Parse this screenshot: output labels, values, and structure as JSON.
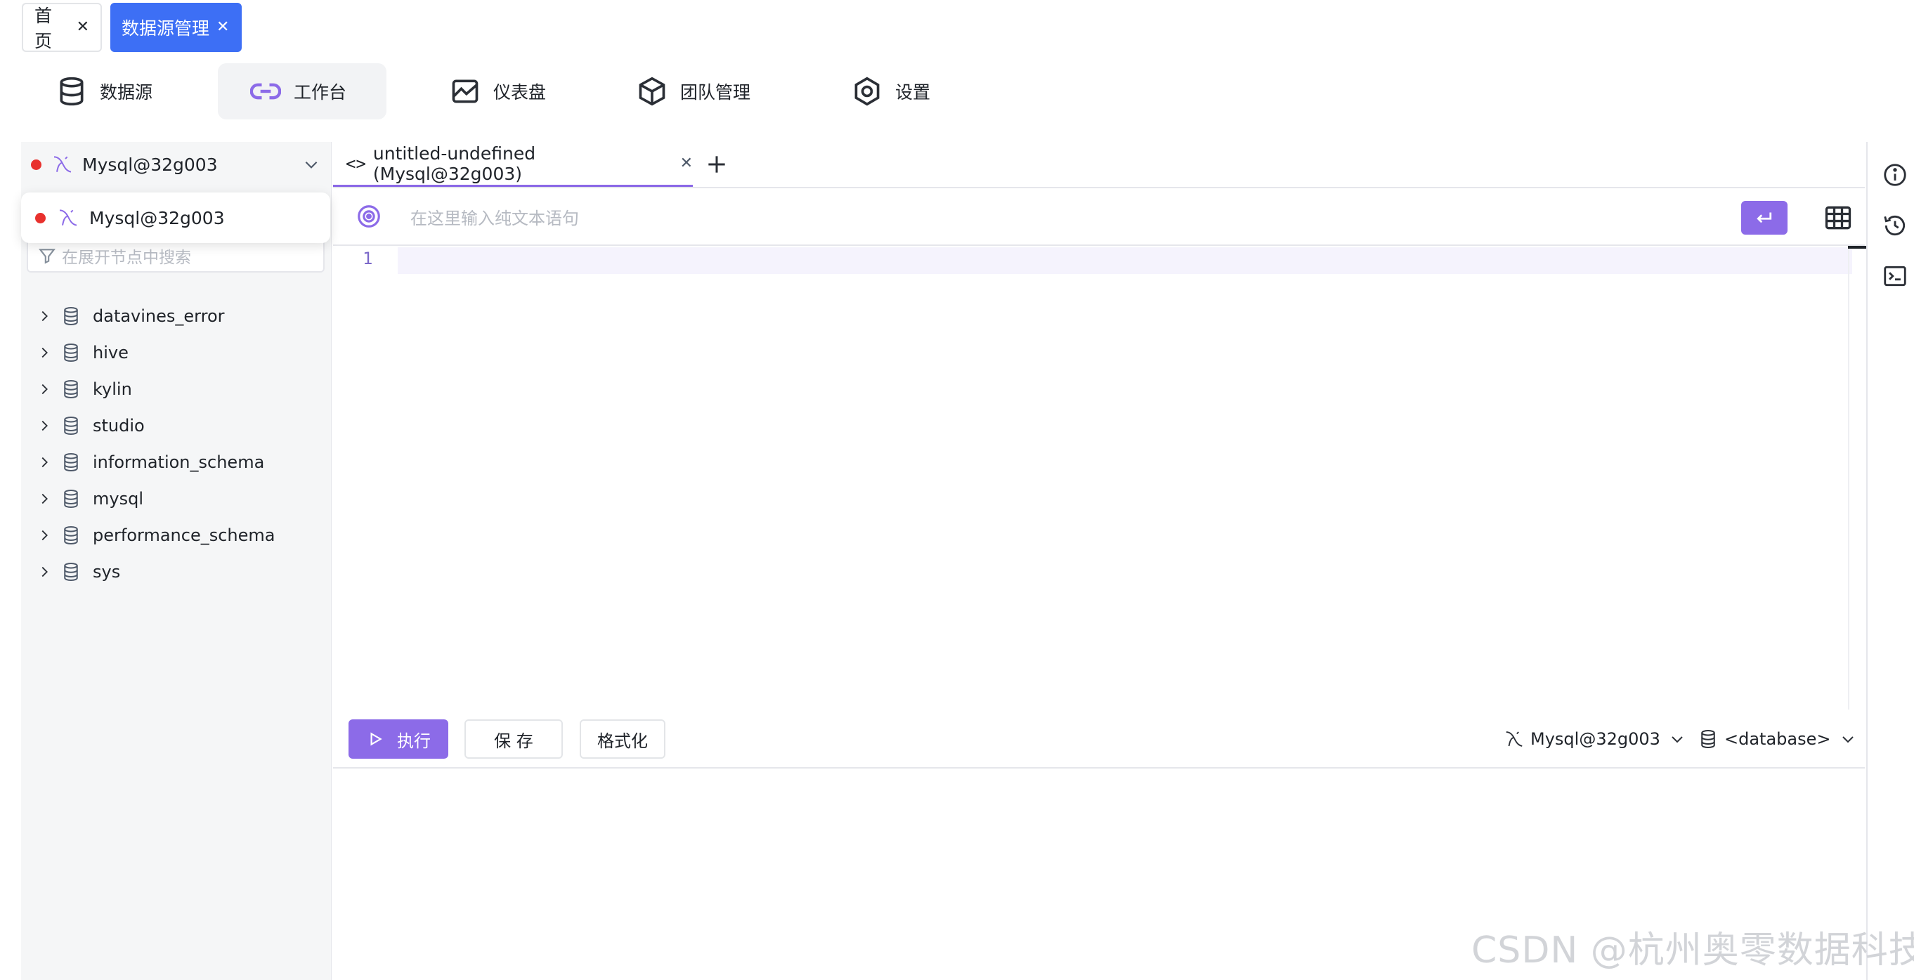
{
  "page_tabs": [
    {
      "label": "首页"
    },
    {
      "label": "数据源管理"
    }
  ],
  "nav": [
    {
      "label": "数据源",
      "icon": "database-icon"
    },
    {
      "label": "工作台",
      "icon": "link-icon"
    },
    {
      "label": "仪表盘",
      "icon": "dashboard-icon"
    },
    {
      "label": "团队管理",
      "icon": "cube-icon"
    },
    {
      "label": "设置",
      "icon": "gear-icon"
    }
  ],
  "left": {
    "datasource": "Mysql@32g003",
    "dropdown_option": "Mysql@32g003",
    "filter_placeholder": "在展开节点中搜索",
    "databases": [
      "datavines_error",
      "hive",
      "kylin",
      "studio",
      "information_schema",
      "mysql",
      "performance_schema",
      "sys"
    ]
  },
  "editor": {
    "tab_label": "untitled-undefined (Mysql@32g003)",
    "ai_placeholder": "在这里输入纯文本语句",
    "line_number": "1"
  },
  "actions": {
    "run": "执行",
    "save": "保 存",
    "format": "格式化",
    "datasource": "Mysql@32g003",
    "database": "<database>"
  },
  "watermark": "CSDN @杭州奥零数据科技",
  "colors": {
    "primary": "#3d6ff5",
    "accent": "#8c6be8",
    "status_dot": "#e8312d"
  }
}
